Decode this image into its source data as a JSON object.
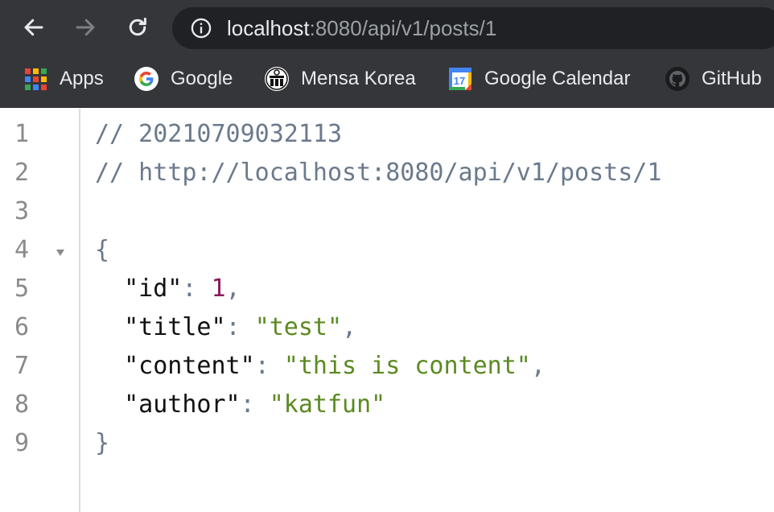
{
  "browser": {
    "url_host": "localhost",
    "url_rest": ":8080/api/v1/posts/1"
  },
  "bookmarks": [
    {
      "label": "Apps",
      "icon": "apps-grid-icon"
    },
    {
      "label": "Google",
      "icon": "google-logo-icon"
    },
    {
      "label": "Mensa Korea",
      "icon": "mensa-logo-icon"
    },
    {
      "label": "Google Calendar",
      "icon": "calendar-icon",
      "icon_text": "17"
    },
    {
      "label": "GitHub",
      "icon": "github-icon"
    }
  ],
  "code": {
    "line_numbers": [
      "1",
      "2",
      "3",
      "4",
      "5",
      "6",
      "7",
      "8",
      "9"
    ],
    "comment_timestamp": "// 20210709032113",
    "comment_url": "// http://localhost:8080/api/v1/posts/1",
    "open_brace": "{",
    "close_brace": "}",
    "fields": [
      {
        "key": "\"id\"",
        "value": "1",
        "type": "number",
        "trail": ","
      },
      {
        "key": "\"title\"",
        "value": "\"test\"",
        "type": "string",
        "trail": ","
      },
      {
        "key": "\"content\"",
        "value": "\"this is content\"",
        "type": "string",
        "trail": ","
      },
      {
        "key": "\"author\"",
        "value": "\"katfun\"",
        "type": "string",
        "trail": ""
      }
    ],
    "colon": ": "
  },
  "colors": {
    "toolbar_bg": "#35363a",
    "omnibox_bg": "#202124",
    "comment": "#6a7a8c",
    "number": "#8a1a5a",
    "string": "#5c8a22"
  }
}
